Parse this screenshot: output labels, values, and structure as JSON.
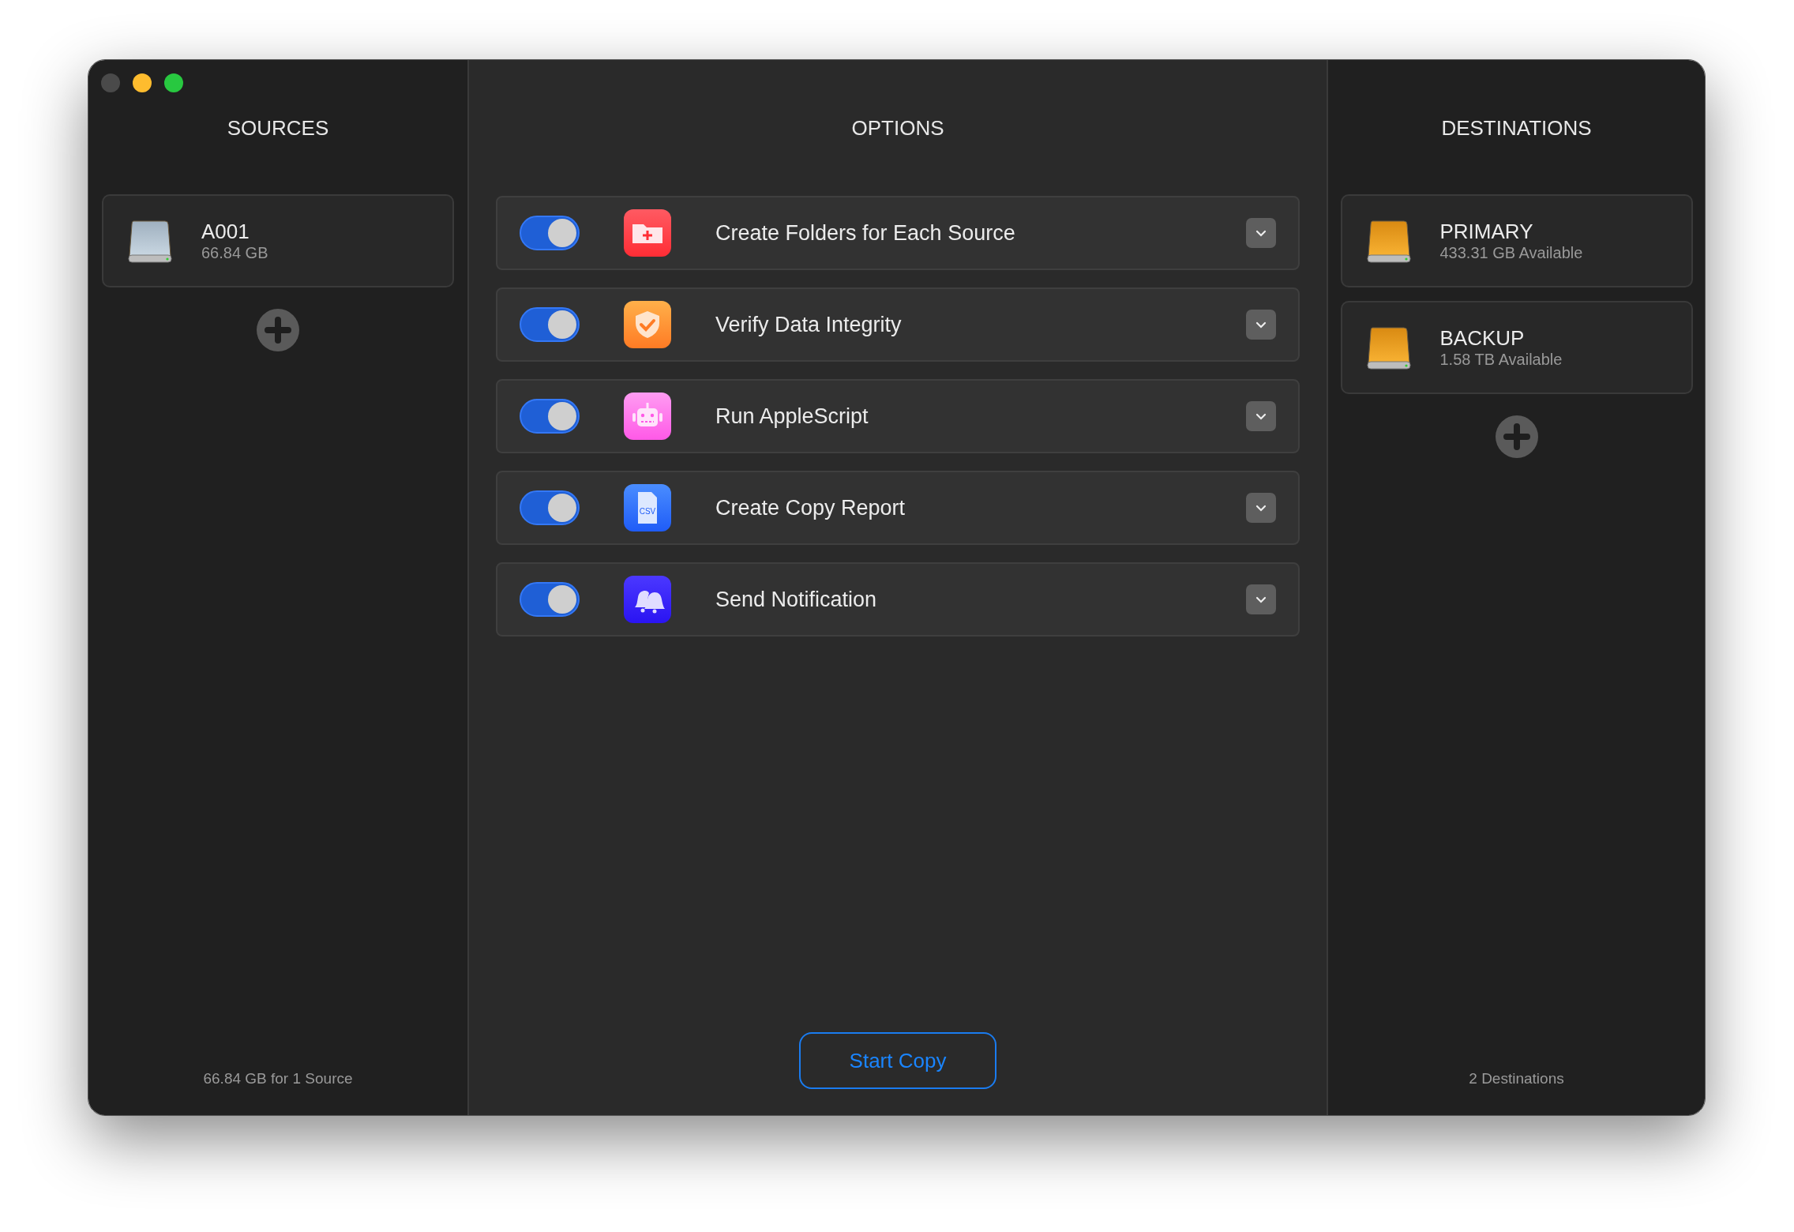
{
  "window": {
    "controls": [
      {
        "kind": "close",
        "disabled": true
      },
      {
        "kind": "minimize",
        "disabled": false
      },
      {
        "kind": "zoom",
        "disabled": false
      }
    ]
  },
  "sources": {
    "title": "SOURCES",
    "items": [
      {
        "name": "A001",
        "detail": "66.84 GB",
        "kind": "silver"
      }
    ],
    "footer": "66.84 GB for 1 Source"
  },
  "options": {
    "title": "OPTIONS",
    "items": [
      {
        "on": true,
        "kind": "folder",
        "label": "Create Folders for Each Source"
      },
      {
        "on": true,
        "kind": "shield",
        "label": "Verify Data Integrity"
      },
      {
        "on": true,
        "kind": "robot",
        "label": "Run AppleScript"
      },
      {
        "on": true,
        "kind": "csv",
        "label": "Create Copy Report",
        "icon_text": "CSV"
      },
      {
        "on": true,
        "kind": "bells",
        "label": "Send Notification"
      }
    ],
    "button": "Start Copy"
  },
  "destinations": {
    "title": "DESTINATIONS",
    "items": [
      {
        "name": "PRIMARY",
        "detail": "433.31 GB Available",
        "kind": "orange"
      },
      {
        "name": "BACKUP",
        "detail": "1.58 TB Available",
        "kind": "orange"
      }
    ],
    "footer": "2 Destinations"
  }
}
